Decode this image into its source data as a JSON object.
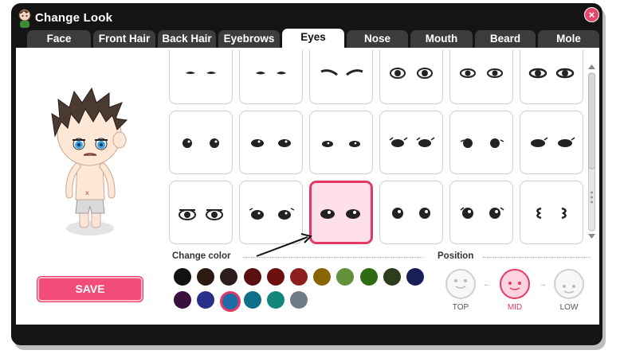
{
  "window": {
    "title": "Change Look",
    "close_icon": "×"
  },
  "tabs": [
    {
      "label": "Face"
    },
    {
      "label": "Front Hair"
    },
    {
      "label": "Back Hair"
    },
    {
      "label": "Eyebrows"
    },
    {
      "label": "Eyes",
      "active": true
    },
    {
      "label": "Nose"
    },
    {
      "label": "Mouth"
    },
    {
      "label": "Beard"
    },
    {
      "label": "Mole"
    }
  ],
  "save_label": "SAVE",
  "change_color_title": "Change color",
  "position_title": "Position",
  "colors": [
    "#121212",
    "#2a1a12",
    "#2d1d1d",
    "#5a0f10",
    "#6b0f10",
    "#8c1e1e",
    "#8a6400",
    "#62913a",
    "#2f6b12",
    "#2b3d1a",
    "#1a1f56",
    "#3b0f3b",
    "#2a2f8a",
    "#1e6ba5",
    "#0f6f8a",
    "#13857a",
    "#6f7b85"
  ],
  "selected_color_index": 13,
  "positions": [
    {
      "label": "TOP"
    },
    {
      "label": "MID",
      "active": true
    },
    {
      "label": "LOW"
    }
  ],
  "selected_eye_index": 14,
  "icons": {
    "title": "avatar-icon",
    "close": "close-icon",
    "scroll_up": "arrow-up-icon",
    "scroll_down": "arrow-down-icon",
    "pointer": "pointer-arrow-icon"
  }
}
